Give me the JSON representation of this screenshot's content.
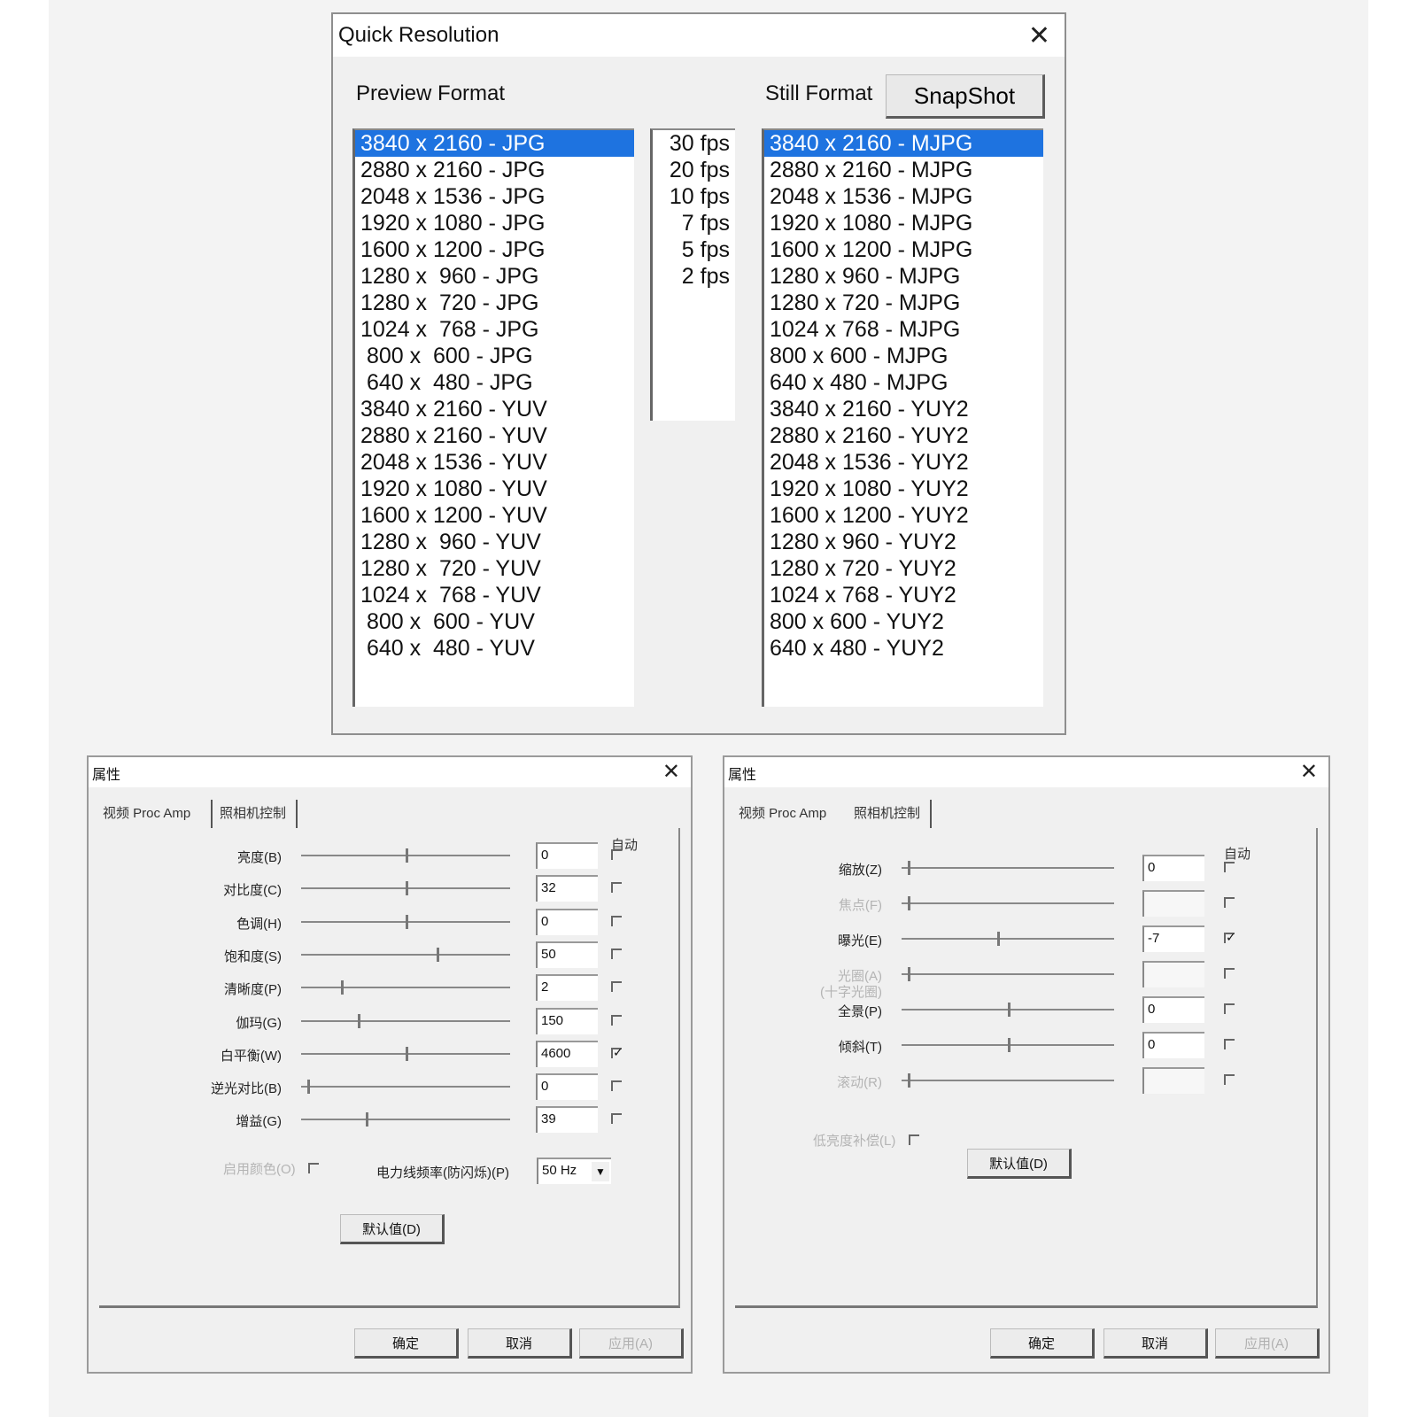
{
  "quick_resolution": {
    "title": "Quick Resolution",
    "preview_label": "Preview Format",
    "still_label": "Still Format",
    "snapshot_button": "SnapShot",
    "preview_formats": [
      "3840 x 2160 - JPG",
      "2880 x 2160 - JPG",
      "2048 x 1536 - JPG",
      "1920 x 1080 - JPG",
      "1600 x 1200 - JPG",
      "1280 x  960 - JPG",
      "1280 x  720 - JPG",
      "1024 x  768 - JPG",
      " 800 x  600 - JPG",
      " 640 x  480 - JPG",
      "3840 x 2160 - YUV",
      "2880 x 2160 - YUV",
      "2048 x 1536 - YUV",
      "1920 x 1080 - YUV",
      "1600 x 1200 - YUV",
      "1280 x  960 - YUV",
      "1280 x  720 - YUV",
      "1024 x  768 - YUV",
      " 800 x  600 - YUV",
      " 640 x  480 - YUV"
    ],
    "fps_options": [
      "30 fps",
      "20 fps",
      "10 fps",
      "7 fps",
      "5 fps",
      "2 fps"
    ],
    "still_formats": [
      "3840 x 2160 - MJPG",
      "2880 x 2160 - MJPG",
      "2048 x 1536 - MJPG",
      "1920 x 1080 - MJPG",
      "1600 x 1200 - MJPG",
      "1280 x 960 - MJPG",
      "1280 x 720 - MJPG",
      "1024 x 768 - MJPG",
      "800 x 600 - MJPG",
      "640 x 480 - MJPG",
      "3840 x 2160 - YUY2",
      "2880 x 2160 - YUY2",
      "2048 x 1536 - YUY2",
      "1920 x 1080 - YUY2",
      "1600 x 1200 - YUY2",
      "1280 x 960 - YUY2",
      "1280 x 720 - YUY2",
      "1024 x 768 - YUY2",
      "800 x 600 - YUY2",
      "640 x 480 - YUY2"
    ],
    "selected_preview": 0,
    "selected_still": 0,
    "colors": {
      "selection": "#1e73e0"
    }
  },
  "proc_amp": {
    "title": "属性",
    "tabs": [
      "视频 Proc Amp",
      "照相机控制"
    ],
    "auto_header": "自动",
    "rows": [
      {
        "label": "亮度(B)",
        "value": "0",
        "level": 0.5,
        "auto": false
      },
      {
        "label": "对比度(C)",
        "value": "32",
        "level": 0.5,
        "auto": false
      },
      {
        "label": "色调(H)",
        "value": "0",
        "level": 0.5,
        "auto": false
      },
      {
        "label": "饱和度(S)",
        "value": "50",
        "level": 0.65,
        "auto": false
      },
      {
        "label": "清晰度(P)",
        "value": "2",
        "level": 0.19,
        "auto": false
      },
      {
        "label": "伽玛(G)",
        "value": "150",
        "level": 0.27,
        "auto": false
      },
      {
        "label": "白平衡(W)",
        "value": "4600",
        "level": 0.5,
        "auto": true
      },
      {
        "label": "逆光对比(B)",
        "value": "0",
        "level": 0.03,
        "auto": false
      },
      {
        "label": "增益(G)",
        "value": "39",
        "level": 0.31,
        "auto": false
      }
    ],
    "color_enable_label": "启用颜色(O)",
    "powerline_label": "电力线频率(防闪烁)(P)",
    "powerline_value": "50 Hz",
    "default_button": "默认值(D)",
    "ok_button": "确定",
    "cancel_button": "取消",
    "apply_button": "应用(A)"
  },
  "camera_control": {
    "title": "属性",
    "tabs": [
      "视频 Proc Amp",
      "照相机控制"
    ],
    "auto_header": "自动",
    "rows": [
      {
        "label": "缩放(Z)",
        "value": "0",
        "level": 0.03,
        "auto": false,
        "enabled": true
      },
      {
        "label": "焦点(F)",
        "value": "",
        "level": 0.03,
        "auto": false,
        "enabled": false
      },
      {
        "label": "曝光(E)",
        "value": "-7",
        "level": 0.45,
        "auto": true,
        "enabled": true
      },
      {
        "label": "光圈(A)",
        "label2": "(十字光圈)",
        "value": "",
        "level": 0.03,
        "auto": false,
        "enabled": false
      },
      {
        "label": "全景(P)",
        "value": "0",
        "level": 0.5,
        "auto": false,
        "enabled": true
      },
      {
        "label": "倾斜(T)",
        "value": "0",
        "level": 0.5,
        "auto": false,
        "enabled": true
      },
      {
        "label": "滚动(R)",
        "value": "",
        "level": 0.03,
        "auto": false,
        "enabled": false
      }
    ],
    "low_light_label": "低亮度补偿(L)",
    "default_button": "默认值(D)",
    "ok_button": "确定",
    "cancel_button": "取消",
    "apply_button": "应用(A)"
  }
}
